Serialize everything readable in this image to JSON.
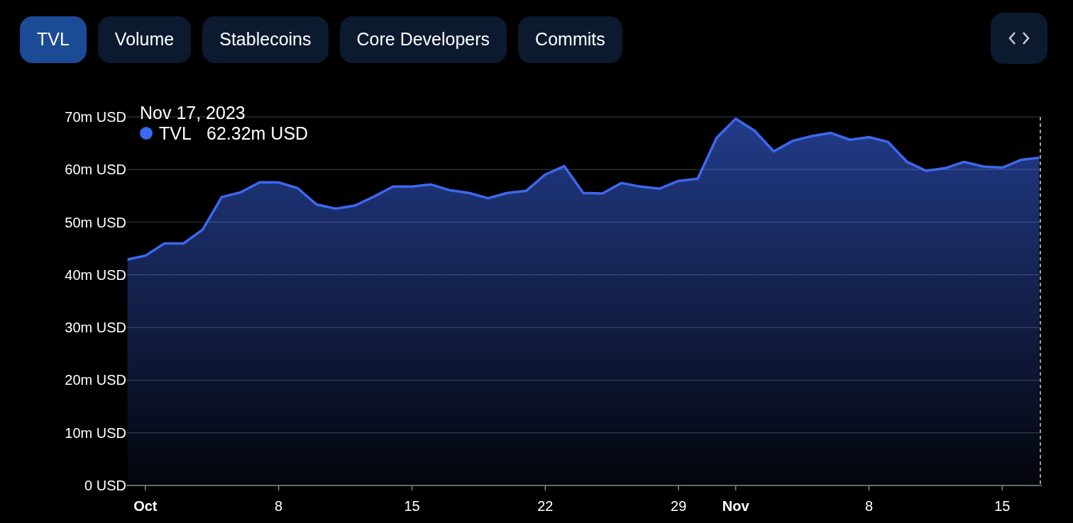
{
  "tabs": [
    {
      "label": "TVL",
      "selected": true
    },
    {
      "label": "Volume",
      "selected": false
    },
    {
      "label": "Stablecoins",
      "selected": false
    },
    {
      "label": "Core Developers",
      "selected": false
    },
    {
      "label": "Commits",
      "selected": false
    }
  ],
  "chart": {
    "tooltip": {
      "date": "Nov 17, 2023",
      "value": "62.32m USD"
    },
    "chart_data": {
      "type": "area",
      "x": [
        "2023-09-30",
        "2023-10-01",
        "2023-10-02",
        "2023-10-03",
        "2023-10-04",
        "2023-10-05",
        "2023-10-06",
        "2023-10-07",
        "2023-10-08",
        "2023-10-09",
        "2023-10-10",
        "2023-10-11",
        "2023-10-12",
        "2023-10-13",
        "2023-10-14",
        "2023-10-15",
        "2023-10-16",
        "2023-10-17",
        "2023-10-18",
        "2023-10-19",
        "2023-10-20",
        "2023-10-21",
        "2023-10-22",
        "2023-10-23",
        "2023-10-24",
        "2023-10-25",
        "2023-10-26",
        "2023-10-27",
        "2023-10-28",
        "2023-10-29",
        "2023-10-30",
        "2023-10-31",
        "2023-11-01",
        "2023-11-02",
        "2023-11-03",
        "2023-11-04",
        "2023-11-05",
        "2023-11-06",
        "2023-11-07",
        "2023-11-08",
        "2023-11-09",
        "2023-11-10",
        "2023-11-11",
        "2023-11-12",
        "2023-11-13",
        "2023-11-14",
        "2023-11-15",
        "2023-11-16",
        "2023-11-17"
      ],
      "series": [
        {
          "name": "TVL",
          "color": "#3d68f0",
          "values": [
            42.9,
            43.7,
            46.0,
            46.0,
            48.6,
            54.8,
            55.7,
            57.6,
            57.6,
            56.5,
            53.4,
            52.6,
            53.2,
            54.9,
            56.8,
            56.8,
            57.2,
            56.1,
            55.6,
            54.6,
            55.6,
            56.0,
            59.1,
            60.7,
            55.6,
            55.5,
            57.5,
            56.8,
            56.4,
            57.9,
            58.3,
            66.1,
            69.7,
            67.4,
            63.5,
            65.5,
            66.4,
            67.0,
            65.7,
            66.2,
            65.3,
            61.5,
            59.8,
            60.3,
            61.5,
            60.6,
            60.4,
            61.9,
            62.3
          ]
        }
      ],
      "xlim": [
        "2023-09-30",
        "2023-11-17"
      ],
      "ylim": [
        0,
        70
      ],
      "grid": true,
      "xticks": [
        {
          "value": "2023-10-01",
          "label": "Oct"
        },
        {
          "value": "2023-10-08",
          "label": "8"
        },
        {
          "value": "2023-10-15",
          "label": "15"
        },
        {
          "value": "2023-10-22",
          "label": "22"
        },
        {
          "value": "2023-10-29",
          "label": "29"
        },
        {
          "value": "2023-11-01",
          "label": "Nov"
        },
        {
          "value": "2023-11-08",
          "label": "8"
        },
        {
          "value": "2023-11-15",
          "label": "15"
        }
      ],
      "yticks": [
        {
          "value": 0,
          "label": "0 USD"
        },
        {
          "value": 10,
          "label": "10m USD"
        },
        {
          "value": 20,
          "label": "20m USD"
        },
        {
          "value": 30,
          "label": "30m USD"
        },
        {
          "value": 40,
          "label": "40m USD"
        },
        {
          "value": 50,
          "label": "50m USD"
        },
        {
          "value": 60,
          "label": "60m USD"
        },
        {
          "value": 70,
          "label": "70m USD"
        }
      ]
    }
  }
}
